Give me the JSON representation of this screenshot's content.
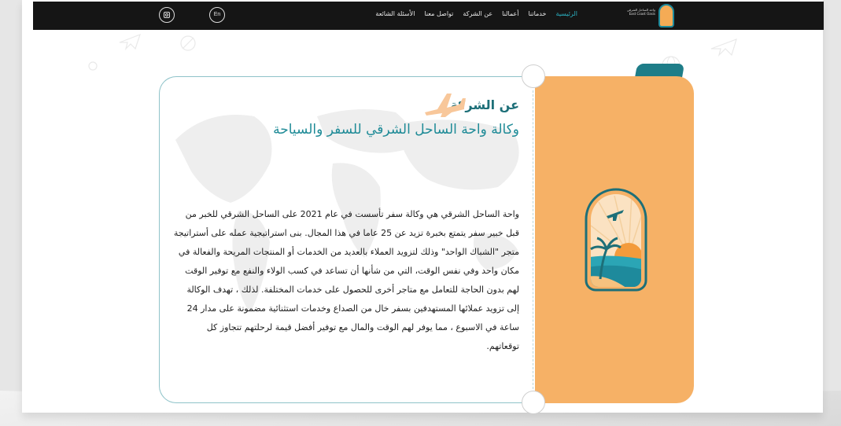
{
  "navbar": {
    "logo_text": "واحة الساحل الشرقي East Coast Oasis",
    "links": [
      {
        "label": "الرئيسية",
        "active": true
      },
      {
        "label": "خدماتنا",
        "active": false
      },
      {
        "label": "أعمالنا",
        "active": false
      },
      {
        "label": "عن الشركة",
        "active": false
      },
      {
        "label": "تواصل معنا",
        "active": false
      },
      {
        "label": "الأسئلة الشائعة",
        "active": false
      }
    ],
    "lang_button": "En",
    "instagram_icon": "instagram-icon"
  },
  "about": {
    "title": "عن الشركة",
    "subtitle": "وكالة واحة الساحل الشرقي للسفر والسياحة",
    "body": "واحة الساحل الشرقي هي وكالة سفر تأسست في عام 2021 على الساحل الشرقي للخبر من قبل خبير سفر يتمتع بخبرة تزيد عن 25 عاما في هذا المجال. بنى استراتيجية عمله على أستراتيجة متجر \"الشباك الواحد\" وذلك لتزويد العملاء بالعديد من الخدمات أو المنتجات المريحة والفعالة في مكان واحد وفي نفس الوقت، التي من شأنها أن تساعد في كسب الولاء والنفع مع توفير الوقت لهم بدون الحاجة للتعامل مع متاجر أخرى للحصول على خدمات المختلفة. لذلك ، تهدف الوكالة إلى تزويد عملائها المستهدفين بسفر خال من الصداع وخدمات استثنائية مضمونة على مدار 24 ساعة في الاسبوع ، مما يوفر لهم الوقت والمال مع توفير أفضل قيمة لرحلتهم تتجاوز كل توقعاتهم."
  },
  "colors": {
    "navbar": "#151515",
    "accent_teal": "#1e8a9c",
    "active_link": "#2bb0c0",
    "ticket_orange": "#f6b166",
    "title": "#1d6f78"
  }
}
